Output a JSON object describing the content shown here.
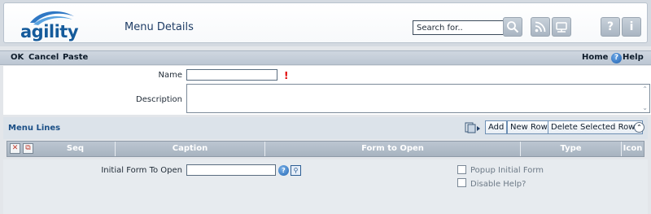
{
  "header": {
    "logo_text": "agility",
    "page_title": "Menu Details",
    "search": {
      "placeholder": "Search for..",
      "value": ""
    },
    "buttons": {
      "search_icon": "magnifier-icon",
      "rss_icon": "rss-icon",
      "network_icon": "network-icon",
      "help_label": "?",
      "info_label": "i"
    }
  },
  "toolbar": {
    "ok": "OK",
    "cancel": "Cancel",
    "paste": "Paste",
    "home": "Home",
    "help": "Help"
  },
  "form": {
    "name_label": "Name",
    "name_value": "",
    "required_mark": "!",
    "description_label": "Description",
    "description_value": ""
  },
  "menu_lines": {
    "title": "Menu Lines",
    "buttons": {
      "add": "Add",
      "new_row": "New Row",
      "delete_selected_rows": "Delete Selected Rows"
    },
    "columns": [
      "Seq",
      "Caption",
      "Form to Open",
      "Type",
      "Icon"
    ]
  },
  "bottom": {
    "initial_form_label": "Initial Form To Open",
    "initial_form_value": "",
    "popup_initial_form": "Popup Initial Form",
    "disable_help": "Disable Help?",
    "popup_checked": false,
    "disable_help_checked": false
  },
  "colors": {
    "accent": "#155b9b",
    "required": "#e10000",
    "toolbar_bg": "#c7d0da"
  }
}
